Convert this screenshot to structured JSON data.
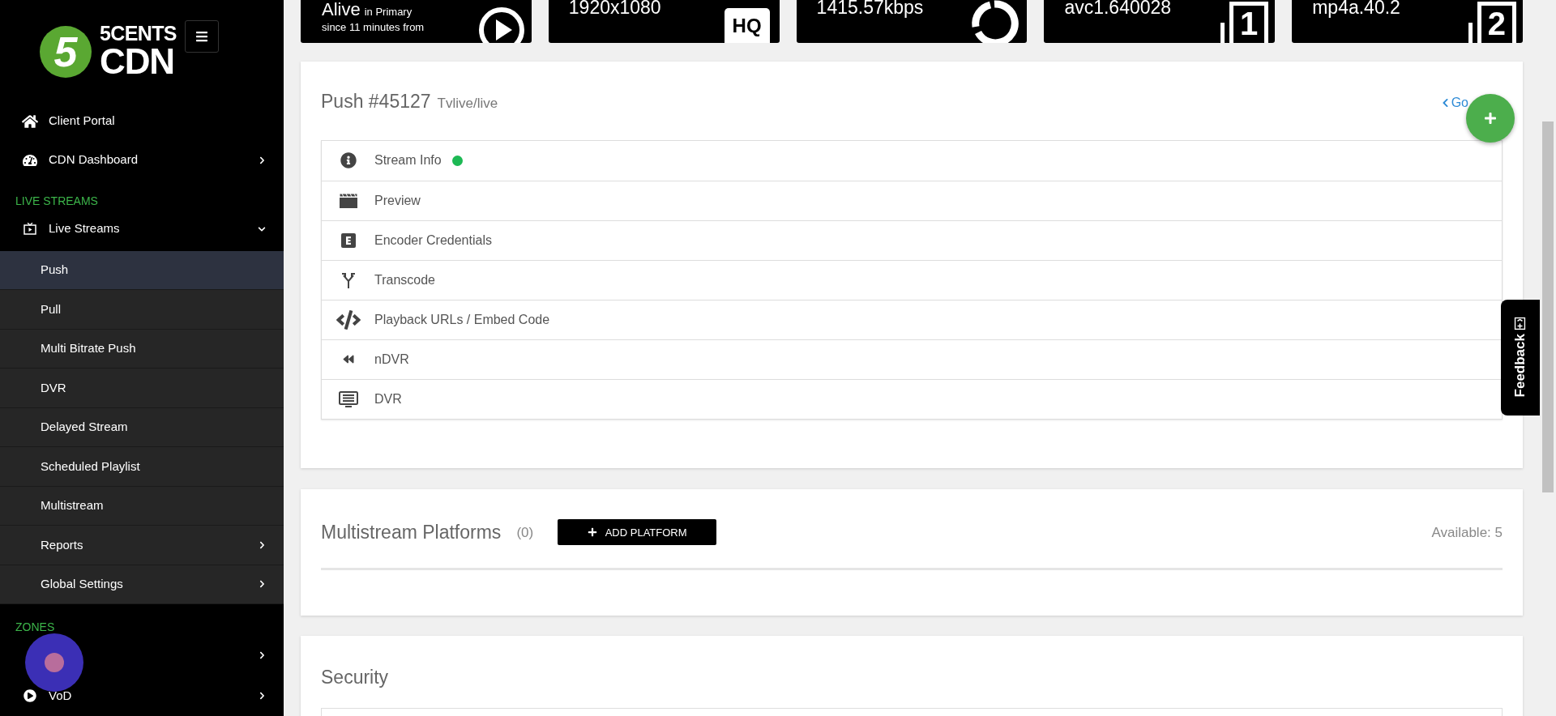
{
  "sidebar": {
    "logo": {
      "digit": "5",
      "line1": "5CENTS",
      "line2": "CDN"
    },
    "items": [
      {
        "kind": "link",
        "label": "Client Portal"
      },
      {
        "kind": "menu",
        "label": "CDN Dashboard",
        "expanded": false
      }
    ],
    "sections": [
      {
        "heading": "LIVE STREAMS",
        "items": [
          {
            "kind": "menu",
            "label": "Live Streams",
            "expanded": true,
            "children": [
              {
                "kind": "link",
                "label": "Push",
                "selected": true
              },
              {
                "kind": "link",
                "label": "Pull",
                "selected": false
              },
              {
                "kind": "link",
                "label": "Multi Bitrate Push",
                "selected": false
              },
              {
                "kind": "link",
                "label": "DVR",
                "selected": false
              },
              {
                "kind": "link",
                "label": "Delayed Stream",
                "selected": false
              },
              {
                "kind": "link",
                "label": "Scheduled Playlist",
                "selected": false
              },
              {
                "kind": "link",
                "label": "Multistream",
                "selected": false
              },
              {
                "kind": "menu",
                "label": "Reports",
                "selected": false
              },
              {
                "kind": "menu",
                "label": "Global Settings",
                "selected": false
              }
            ]
          }
        ]
      },
      {
        "heading": "ZONES",
        "items": [
          {
            "kind": "menu",
            "expanded": false
          },
          {
            "kind": "menu",
            "label": "VoD",
            "expanded": false
          }
        ]
      }
    ]
  },
  "stats": [
    {
      "kind": "alive",
      "value": "Alive",
      "note": "in Primary",
      "sub": "since 11 minutes from"
    },
    {
      "kind": "resolution",
      "value": "1920x1080",
      "badge": "HQ"
    },
    {
      "kind": "bitrate",
      "value": "1415.57kbps"
    },
    {
      "kind": "track",
      "value": "avc1.640028",
      "badge": "1"
    },
    {
      "kind": "track",
      "value": "mp4a.40.2",
      "badge": "2"
    }
  ],
  "push": {
    "title": "Push #45127",
    "subtitle": "Tvlive/live",
    "back_link": "Go",
    "rows": [
      {
        "label": "Stream Info",
        "live": true
      },
      {
        "label": "Preview",
        "live": false
      },
      {
        "label": "Encoder Credentials",
        "live": false
      },
      {
        "label": "Transcode",
        "live": false
      },
      {
        "label": "Playback URLs / Embed Code",
        "live": false
      },
      {
        "label": "nDVR",
        "live": false
      },
      {
        "label": "DVR",
        "live": false
      }
    ]
  },
  "multistream": {
    "title": "Multistream Platforms",
    "count": "(0)",
    "button": "ADD PLATFORM",
    "available": "Available: 5"
  },
  "security": {
    "title": "Security"
  },
  "feedback": {
    "label": "Feedback"
  }
}
